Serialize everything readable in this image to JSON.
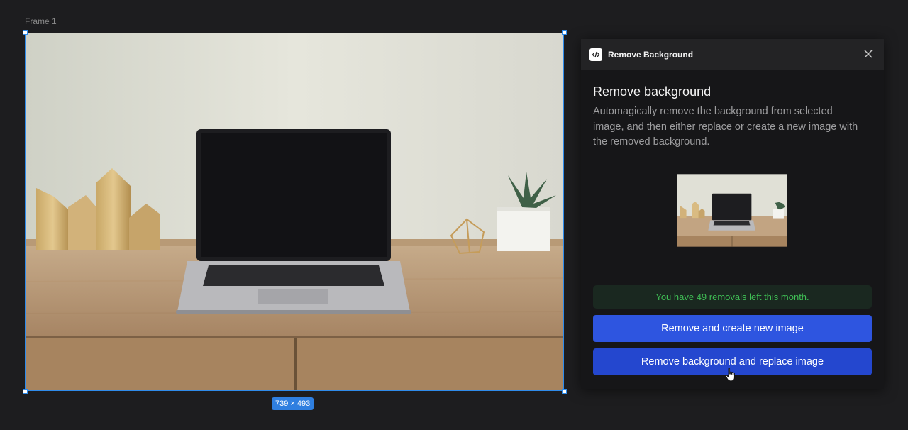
{
  "canvas": {
    "frame_label": "Frame 1",
    "dimensions_badge": "739 × 493",
    "selection_color": "#2f8bea"
  },
  "plugin": {
    "header_title": "Remove Background",
    "title": "Remove background",
    "description": "Automagically remove the background from selected image, and then either replace or create a new image with the removed background.",
    "notice": "You have 49 removals left this month.",
    "primary_button": "Remove and create new image",
    "secondary_button": "Remove background and replace image",
    "colors": {
      "notice_text": "#3fbf55",
      "button_primary": "#2e55e0",
      "button_secondary": "#2447cf"
    },
    "icons": [
      "code-icon",
      "close-icon"
    ]
  }
}
